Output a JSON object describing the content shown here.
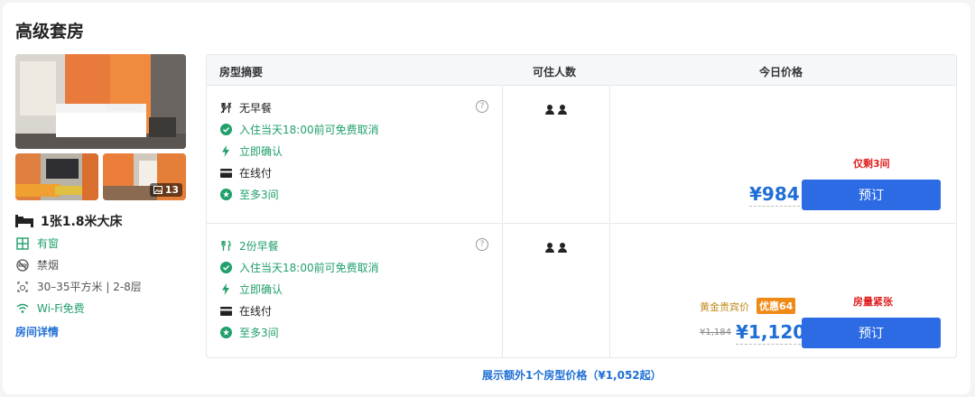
{
  "room": {
    "title": "高级套房",
    "photo_count": "13",
    "bed": "1张1.8米大床",
    "features": [
      {
        "label": "有窗",
        "icon": "window-icon",
        "color": "green"
      },
      {
        "label": "禁烟",
        "icon": "no-smoking-icon",
        "color": "grey"
      },
      {
        "label": "30–35平方米 | 2-8层",
        "icon": "area-icon",
        "color": "grey"
      },
      {
        "label": "Wi-Fi免费",
        "icon": "wifi-icon",
        "color": "green"
      }
    ],
    "details_link": "房间详情"
  },
  "table": {
    "headers": {
      "summary": "房型摘要",
      "guests": "可住人数",
      "price": "今日价格"
    },
    "rows": [
      {
        "meal": "无早餐",
        "cancel": "入住当天18:00前可免费取消",
        "confirm": "立即确认",
        "payment": "在线付",
        "max_rooms": "至多3间",
        "remaining": "仅剩3间",
        "price": "¥984",
        "book_label": "预订"
      },
      {
        "meal": "2份早餐",
        "cancel": "入住当天18:00前可免费取消",
        "confirm": "立即确认",
        "payment": "在线付",
        "max_rooms": "至多3间",
        "remaining": "房量紧张",
        "vip_label": "黄金贵宾价",
        "promo": "优惠64",
        "old_price": "¥1,184",
        "price": "¥1,120",
        "book_label": "预订"
      }
    ]
  },
  "more_link": "展示额外1个房型价格（¥1,052起）",
  "colors": {
    "accent": "#2d6be4",
    "price": "#1f6fd6",
    "green": "#20a06a",
    "alert": "#e02020",
    "promo": "#f08a16"
  }
}
